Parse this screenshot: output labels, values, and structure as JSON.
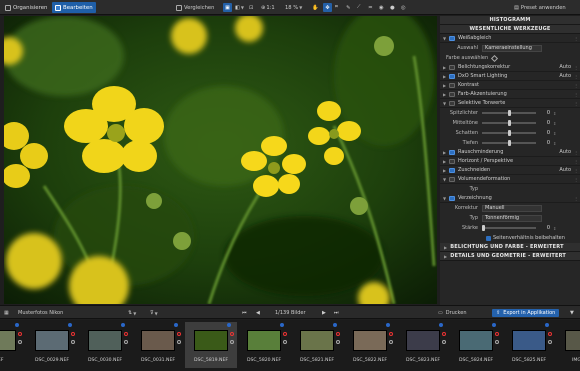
{
  "toolbar": {
    "tab_organize": "Organisieren",
    "tab_edit": "Bearbeiten",
    "compare": "Vergleichen",
    "zoom_1to1": "1:1",
    "zoom_percent": "18 %",
    "apply_preset": "Preset anwenden"
  },
  "panel": {
    "histogram": "HISTOGRAMM",
    "essential_tools": "WESENTLICHE WERKZEUGE",
    "white_balance": {
      "label": "Weißabgleich",
      "selection_label": "Auswahl",
      "selection_value": "Kameraeinstellung",
      "pick_color": "Farbe auswählen"
    },
    "tools": [
      {
        "label": "Belichtungskorrektur",
        "value": "Auto"
      },
      {
        "label": "DxO Smart Lighting",
        "value": "Auto"
      },
      {
        "label": "Kontrast",
        "value": ""
      },
      {
        "label": "Farb-Akzentuierung",
        "value": ""
      }
    ],
    "tone": {
      "label": "Selektive Tonwerte",
      "rows": [
        {
          "label": "Spitzlichter",
          "value": "0"
        },
        {
          "label": "Mitteltöne",
          "value": "0"
        },
        {
          "label": "Schatten",
          "value": "0"
        },
        {
          "label": "Tiefen",
          "value": "0"
        }
      ]
    },
    "tools2": [
      {
        "label": "Rauschminderung",
        "value": "Auto"
      },
      {
        "label": "Horizont / Perspektive",
        "value": ""
      },
      {
        "label": "Zuschneiden",
        "value": "Auto"
      }
    ],
    "vignetting": {
      "label": "Volumendeformation",
      "type_label": "Typ"
    },
    "distortion": {
      "label": "Verzeichnung",
      "correction_label": "Korrektur",
      "correction_value": "Manuell",
      "type_label": "Typ",
      "type_value": "Tonnenförmig",
      "strength_label": "Stärke",
      "strength_value": "0",
      "keep_ratio": "Seitenverhältnis beibehalten"
    },
    "section_exposure": "BELICHTUNG UND FARBE - ERWEITERT",
    "section_details": "DETAILS UND GEOMETRIE - ERWEITERT"
  },
  "bottombar": {
    "project": "Musterfotos Nikon",
    "counter": "1/139 Bilder",
    "print": "Drucken",
    "export": "Export in Applikation"
  },
  "filmstrip": [
    {
      "name": "NEF",
      "color": "#6f7a5a",
      "selected": false
    },
    {
      "name": "DSC_0029.NEF",
      "color": "#5c6b74",
      "selected": false
    },
    {
      "name": "DSC_0030.NEF",
      "color": "#50605a",
      "selected": false
    },
    {
      "name": "DSC_0031.NEF",
      "color": "#6a5a4c",
      "selected": false
    },
    {
      "name": "DSC_5819.NEF",
      "color": "#3a5a18",
      "selected": true
    },
    {
      "name": "DSC_5820.NEF",
      "color": "#597f3a",
      "selected": false
    },
    {
      "name": "DSC_5821.NEF",
      "color": "#6a744a",
      "selected": false
    },
    {
      "name": "DSC_5822.NEF",
      "color": "#7a6a58",
      "selected": false
    },
    {
      "name": "DSC_5823.NEF",
      "color": "#3c3c4a",
      "selected": false
    },
    {
      "name": "DSC_5824.NEF",
      "color": "#4a6a74",
      "selected": false
    },
    {
      "name": "DSC_5825.NEF",
      "color": "#3a5a88",
      "selected": false
    },
    {
      "name": "IMG_321",
      "color": "#585848",
      "selected": false
    }
  ],
  "accent": "#1f5fa8"
}
